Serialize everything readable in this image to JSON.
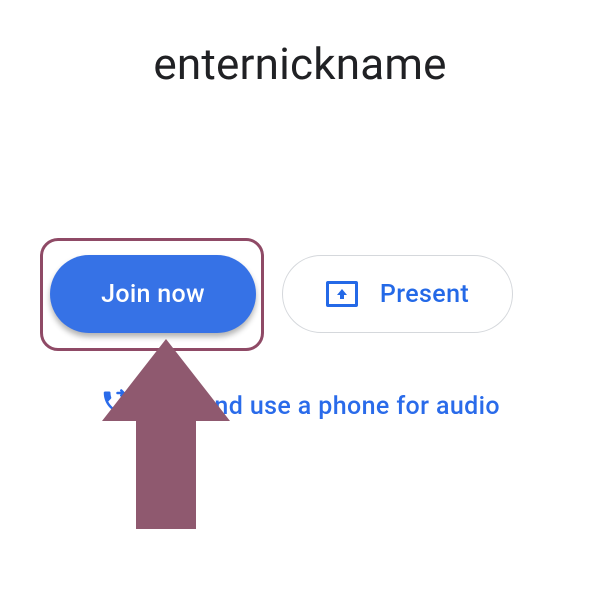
{
  "meeting": {
    "title": "enternickname"
  },
  "buttons": {
    "join": "Join now",
    "present": "Present"
  },
  "phone_audio": {
    "label": "Join and use a phone for audio"
  },
  "annotation": {
    "target_name": "join-now-button"
  }
}
